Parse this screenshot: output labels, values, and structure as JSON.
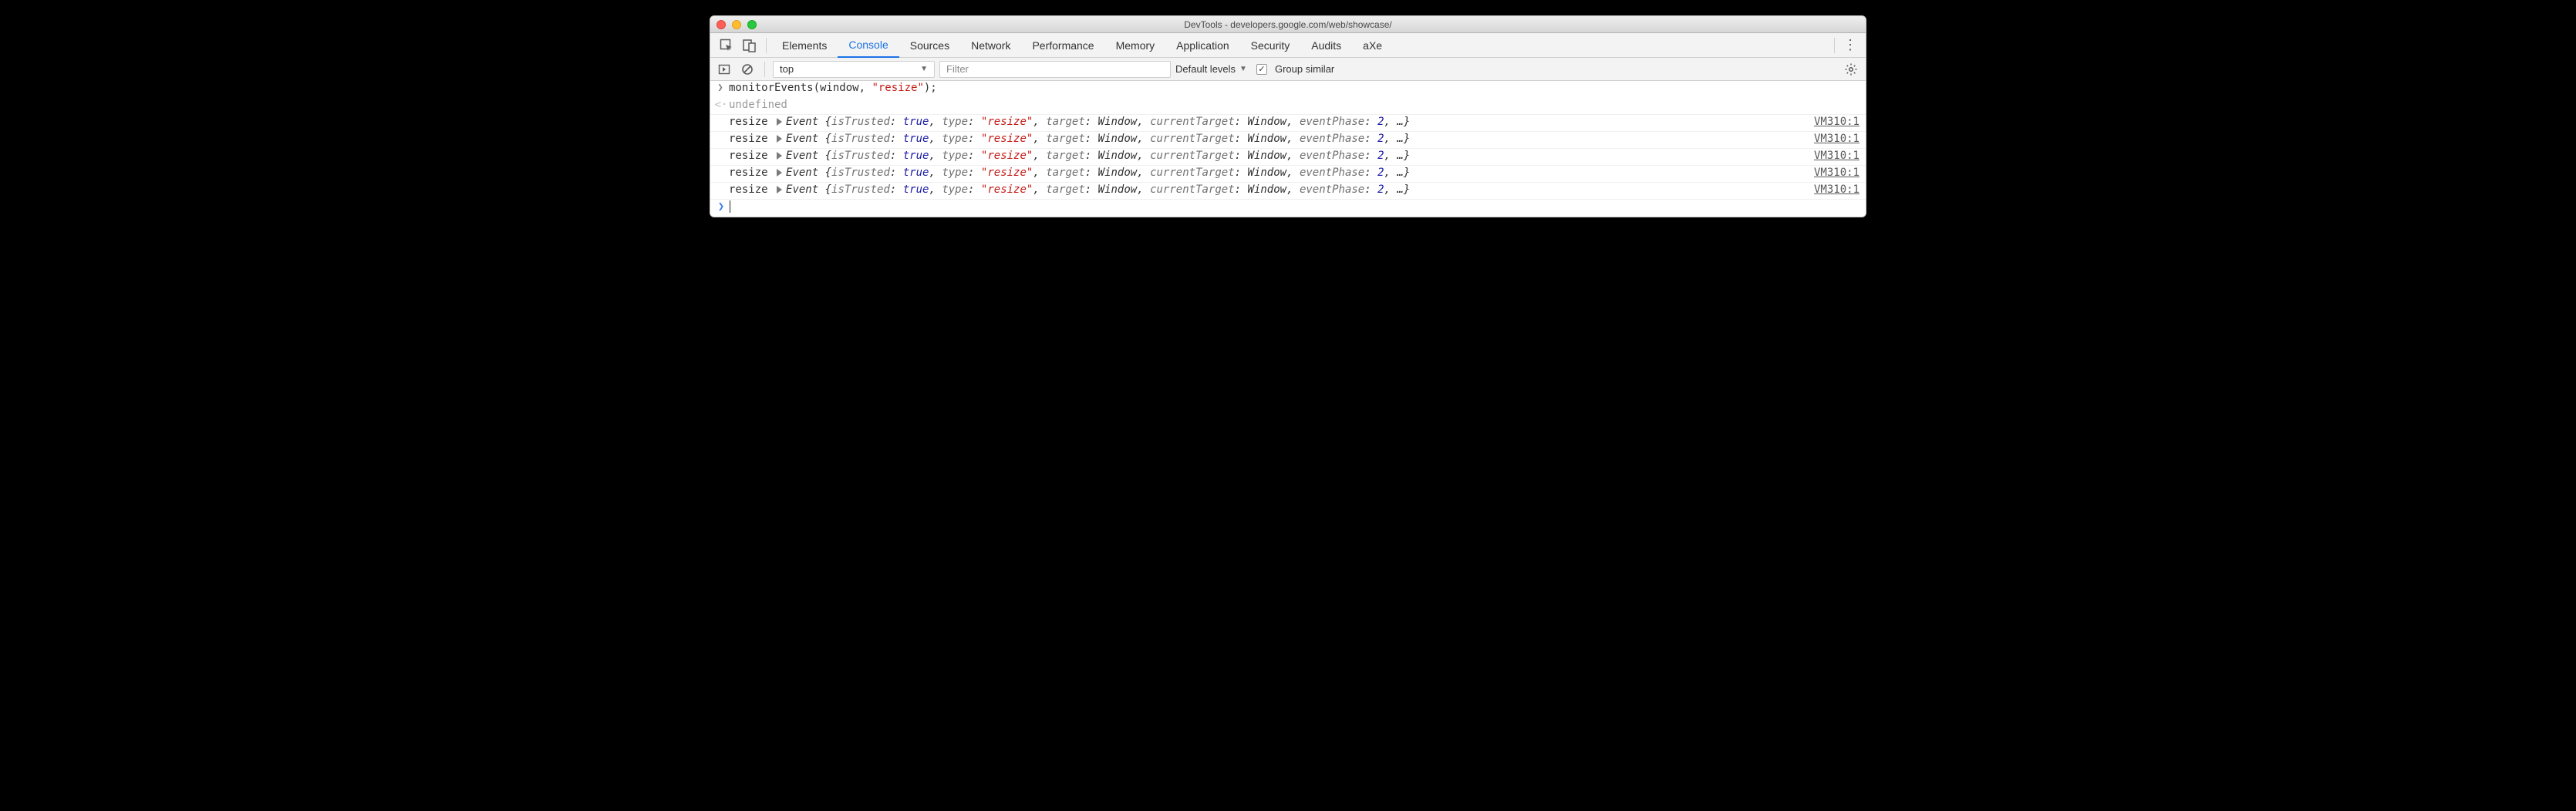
{
  "window": {
    "title": "DevTools - developers.google.com/web/showcase/"
  },
  "tabs": {
    "items": [
      "Elements",
      "Console",
      "Sources",
      "Network",
      "Performance",
      "Memory",
      "Application",
      "Security",
      "Audits",
      "aXe"
    ],
    "active": "Console"
  },
  "toolbar": {
    "context": "top",
    "filter_placeholder": "Filter",
    "filter_value": "",
    "levels_label": "Default levels",
    "group_similar_label": "Group similar",
    "group_similar_checked": true
  },
  "console": {
    "input_line": "monitorEvents(window, \"resize\");",
    "output_line": "undefined",
    "events": [
      {
        "label": "resize",
        "cls": "Event",
        "props": "{isTrusted: true, type: \"resize\", target: Window, currentTarget: Window, eventPhase: 2, …}",
        "source": "VM310:1"
      },
      {
        "label": "resize",
        "cls": "Event",
        "props": "{isTrusted: true, type: \"resize\", target: Window, currentTarget: Window, eventPhase: 2, …}",
        "source": "VM310:1"
      },
      {
        "label": "resize",
        "cls": "Event",
        "props": "{isTrusted: true, type: \"resize\", target: Window, currentTarget: Window, eventPhase: 2, …}",
        "source": "VM310:1"
      },
      {
        "label": "resize",
        "cls": "Event",
        "props": "{isTrusted: true, type: \"resize\", target: Window, currentTarget: Window, eventPhase: 2, …}",
        "source": "VM310:1"
      },
      {
        "label": "resize",
        "cls": "Event",
        "props": "{isTrusted: true, type: \"resize\", target: Window, currentTarget: Window, eventPhase: 2, …}",
        "source": "VM310:1"
      }
    ]
  }
}
